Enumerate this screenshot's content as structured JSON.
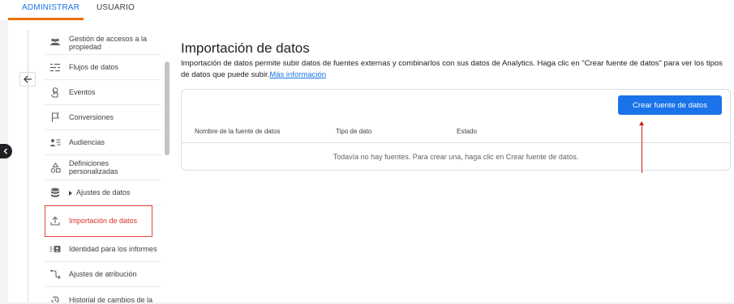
{
  "tabs": [
    {
      "label": "ADMINISTRAR",
      "active": true
    },
    {
      "label": "USUARIO",
      "active": false
    }
  ],
  "nav": {
    "items": [
      {
        "label": "Gestión de accesos a la propiedad",
        "icon": "people-icon"
      },
      {
        "label": "Flujos de datos",
        "icon": "data-streams-icon"
      },
      {
        "label": "Eventos",
        "icon": "touch-icon"
      },
      {
        "label": "Conversiones",
        "icon": "flag-icon"
      },
      {
        "label": "Audiencias",
        "icon": "audience-icon"
      },
      {
        "label": "Definiciones personalizadas",
        "icon": "shapes-icon"
      },
      {
        "label": "Ajustes de datos",
        "icon": "database-icon"
      },
      {
        "label": "Importación de datos",
        "icon": "upload-icon"
      },
      {
        "label": "Identidad para los informes",
        "icon": "identity-icon"
      },
      {
        "label": "Ajustes de atribución",
        "icon": "attribution-icon"
      },
      {
        "label": "Historial de cambios de la",
        "icon": "history-icon"
      }
    ]
  },
  "main": {
    "title": "Importación de datos",
    "description": "Importación de datos permite subir datos de fuentes externas y combinarlos con sus datos de Analytics. Haga clic en \"Crear fuente de datos\" para ver los tipos de datos que puede subir.",
    "more_link": "Más información",
    "create_button": "Crear fuente de datos",
    "table_headers": [
      "Nombre de la fuente de datos",
      "Tipo de dato",
      "Estado"
    ],
    "empty_message": "Todavía no hay fuentes. Para crear una, haga clic en Crear fuente de datos."
  },
  "colors": {
    "accent": "#1a73e8",
    "tab_underline": "#e8710a",
    "active_nav": "#d93025",
    "annotation": "#c5221f"
  }
}
